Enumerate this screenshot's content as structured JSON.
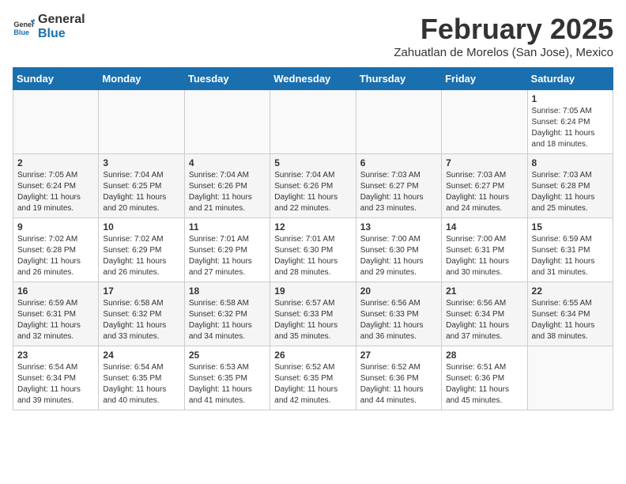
{
  "logo": {
    "general": "General",
    "blue": "Blue"
  },
  "header": {
    "month": "February 2025",
    "location": "Zahuatlan de Morelos (San Jose), Mexico"
  },
  "weekdays": [
    "Sunday",
    "Monday",
    "Tuesday",
    "Wednesday",
    "Thursday",
    "Friday",
    "Saturday"
  ],
  "weeks": [
    [
      {
        "day": "",
        "info": ""
      },
      {
        "day": "",
        "info": ""
      },
      {
        "day": "",
        "info": ""
      },
      {
        "day": "",
        "info": ""
      },
      {
        "day": "",
        "info": ""
      },
      {
        "day": "",
        "info": ""
      },
      {
        "day": "1",
        "info": "Sunrise: 7:05 AM\nSunset: 6:24 PM\nDaylight: 11 hours\nand 18 minutes."
      }
    ],
    [
      {
        "day": "2",
        "info": "Sunrise: 7:05 AM\nSunset: 6:24 PM\nDaylight: 11 hours\nand 19 minutes."
      },
      {
        "day": "3",
        "info": "Sunrise: 7:04 AM\nSunset: 6:25 PM\nDaylight: 11 hours\nand 20 minutes."
      },
      {
        "day": "4",
        "info": "Sunrise: 7:04 AM\nSunset: 6:26 PM\nDaylight: 11 hours\nand 21 minutes."
      },
      {
        "day": "5",
        "info": "Sunrise: 7:04 AM\nSunset: 6:26 PM\nDaylight: 11 hours\nand 22 minutes."
      },
      {
        "day": "6",
        "info": "Sunrise: 7:03 AM\nSunset: 6:27 PM\nDaylight: 11 hours\nand 23 minutes."
      },
      {
        "day": "7",
        "info": "Sunrise: 7:03 AM\nSunset: 6:27 PM\nDaylight: 11 hours\nand 24 minutes."
      },
      {
        "day": "8",
        "info": "Sunrise: 7:03 AM\nSunset: 6:28 PM\nDaylight: 11 hours\nand 25 minutes."
      }
    ],
    [
      {
        "day": "9",
        "info": "Sunrise: 7:02 AM\nSunset: 6:28 PM\nDaylight: 11 hours\nand 26 minutes."
      },
      {
        "day": "10",
        "info": "Sunrise: 7:02 AM\nSunset: 6:29 PM\nDaylight: 11 hours\nand 26 minutes."
      },
      {
        "day": "11",
        "info": "Sunrise: 7:01 AM\nSunset: 6:29 PM\nDaylight: 11 hours\nand 27 minutes."
      },
      {
        "day": "12",
        "info": "Sunrise: 7:01 AM\nSunset: 6:30 PM\nDaylight: 11 hours\nand 28 minutes."
      },
      {
        "day": "13",
        "info": "Sunrise: 7:00 AM\nSunset: 6:30 PM\nDaylight: 11 hours\nand 29 minutes."
      },
      {
        "day": "14",
        "info": "Sunrise: 7:00 AM\nSunset: 6:31 PM\nDaylight: 11 hours\nand 30 minutes."
      },
      {
        "day": "15",
        "info": "Sunrise: 6:59 AM\nSunset: 6:31 PM\nDaylight: 11 hours\nand 31 minutes."
      }
    ],
    [
      {
        "day": "16",
        "info": "Sunrise: 6:59 AM\nSunset: 6:31 PM\nDaylight: 11 hours\nand 32 minutes."
      },
      {
        "day": "17",
        "info": "Sunrise: 6:58 AM\nSunset: 6:32 PM\nDaylight: 11 hours\nand 33 minutes."
      },
      {
        "day": "18",
        "info": "Sunrise: 6:58 AM\nSunset: 6:32 PM\nDaylight: 11 hours\nand 34 minutes."
      },
      {
        "day": "19",
        "info": "Sunrise: 6:57 AM\nSunset: 6:33 PM\nDaylight: 11 hours\nand 35 minutes."
      },
      {
        "day": "20",
        "info": "Sunrise: 6:56 AM\nSunset: 6:33 PM\nDaylight: 11 hours\nand 36 minutes."
      },
      {
        "day": "21",
        "info": "Sunrise: 6:56 AM\nSunset: 6:34 PM\nDaylight: 11 hours\nand 37 minutes."
      },
      {
        "day": "22",
        "info": "Sunrise: 6:55 AM\nSunset: 6:34 PM\nDaylight: 11 hours\nand 38 minutes."
      }
    ],
    [
      {
        "day": "23",
        "info": "Sunrise: 6:54 AM\nSunset: 6:34 PM\nDaylight: 11 hours\nand 39 minutes."
      },
      {
        "day": "24",
        "info": "Sunrise: 6:54 AM\nSunset: 6:35 PM\nDaylight: 11 hours\nand 40 minutes."
      },
      {
        "day": "25",
        "info": "Sunrise: 6:53 AM\nSunset: 6:35 PM\nDaylight: 11 hours\nand 41 minutes."
      },
      {
        "day": "26",
        "info": "Sunrise: 6:52 AM\nSunset: 6:35 PM\nDaylight: 11 hours\nand 42 minutes."
      },
      {
        "day": "27",
        "info": "Sunrise: 6:52 AM\nSunset: 6:36 PM\nDaylight: 11 hours\nand 44 minutes."
      },
      {
        "day": "28",
        "info": "Sunrise: 6:51 AM\nSunset: 6:36 PM\nDaylight: 11 hours\nand 45 minutes."
      },
      {
        "day": "",
        "info": ""
      }
    ]
  ]
}
